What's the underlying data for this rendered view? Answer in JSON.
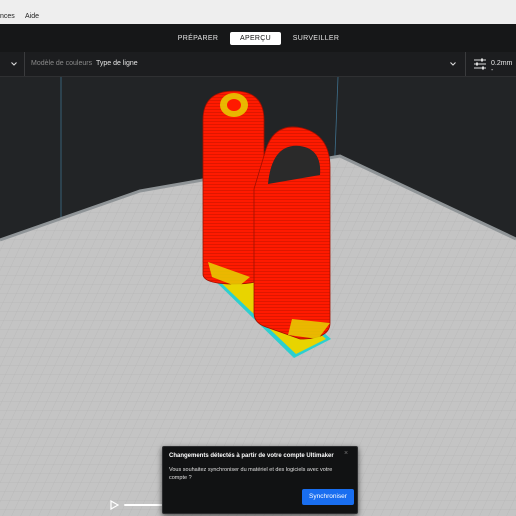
{
  "menubar": {
    "items": [
      "nces",
      "Aide"
    ]
  },
  "stages": [
    {
      "label": "PRÉPARER",
      "active": false
    },
    {
      "label": "APERÇU",
      "active": true
    },
    {
      "label": "SURVEILLER",
      "active": false
    }
  ],
  "toolbar": {
    "color_scheme_label": "Modèle de couleurs",
    "color_scheme_value": "Type de ligne",
    "print_settings_value": "0.2mm -"
  },
  "notification": {
    "title": "Changements détectés à partir de votre compte Ultimaker",
    "body": "Vous souhaitez synchroniser du matériel et des logiciels avec votre compte ?",
    "close_icon": "×",
    "button": "Synchroniser"
  },
  "colors": {
    "accent": "#196ef0",
    "model_red": "#ff1a00",
    "model_yellow": "#e8d400",
    "build_plate": "#c4c4c4",
    "support_cyan": "#33d6d6"
  },
  "icons": {
    "dropdown": "chevron-down-icon",
    "settings": "sliders-icon",
    "play": "play-icon"
  }
}
